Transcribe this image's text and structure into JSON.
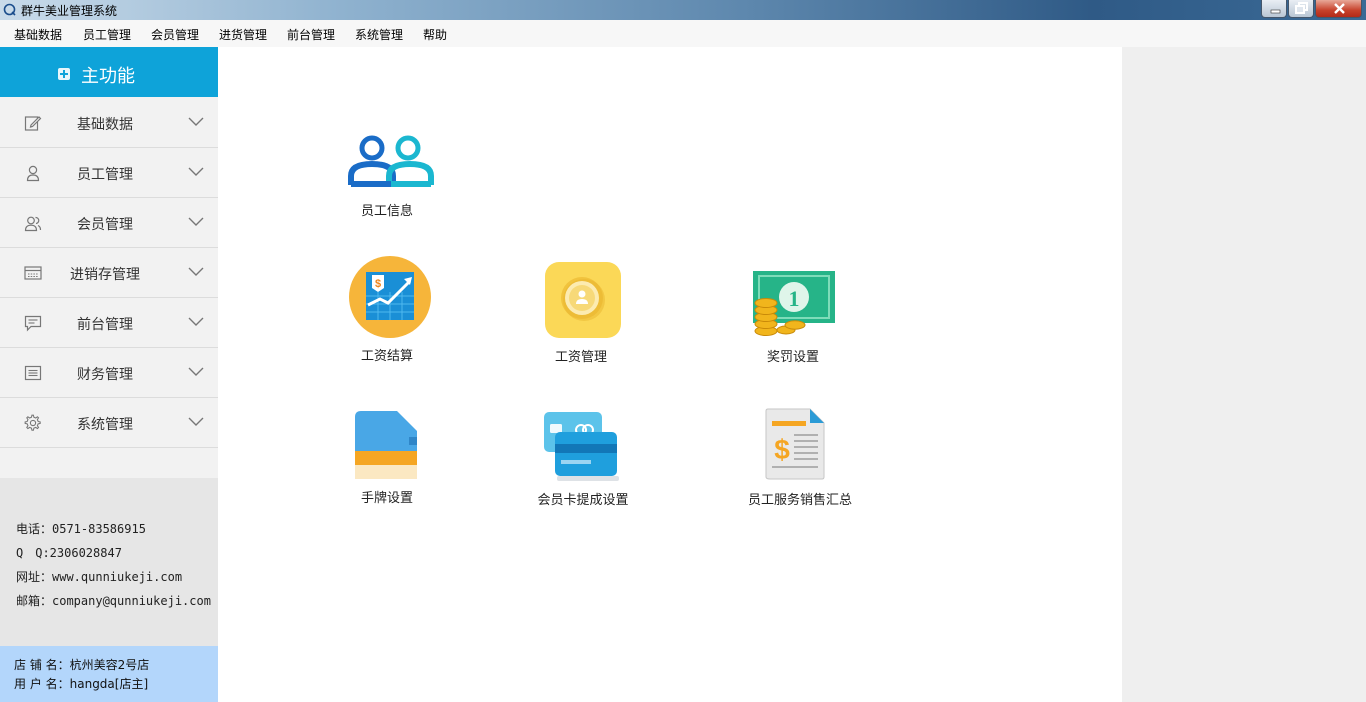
{
  "window": {
    "title": "群牛美业管理系统",
    "buttons": [
      "minimize",
      "maximize",
      "close"
    ]
  },
  "menubar": {
    "items": [
      "基础数据",
      "员工管理",
      "会员管理",
      "进货管理",
      "前台管理",
      "系统管理",
      "帮助"
    ]
  },
  "sidebar": {
    "header": "主功能",
    "items": [
      {
        "label": "基础数据",
        "icon": "edit-icon"
      },
      {
        "label": "员工管理",
        "icon": "person-icon"
      },
      {
        "label": "会员管理",
        "icon": "members-icon"
      },
      {
        "label": "进销存管理",
        "icon": "inventory-icon"
      },
      {
        "label": "前台管理",
        "icon": "message-icon"
      },
      {
        "label": "财务管理",
        "icon": "ledger-icon"
      },
      {
        "label": "系统管理",
        "icon": "gear-icon"
      }
    ]
  },
  "contact": {
    "phone": "电话：0571-83586915",
    "qq": "Q　Q:2306028847",
    "website": "网址：www.qunniukeji.com",
    "email": "邮箱：company@qunniukeji.com"
  },
  "user": {
    "store": "店 铺 名：杭州美容2号店",
    "username": "用 户 名：hangda[店主]"
  },
  "tiles": [
    {
      "label": "员工信息",
      "icon": "employees-icon"
    },
    {
      "label": "工资结算",
      "icon": "salary-chart-icon"
    },
    {
      "label": "工资管理",
      "icon": "coin-icon"
    },
    {
      "label": "奖罚设置",
      "icon": "money-icon"
    },
    {
      "label": "手牌设置",
      "icon": "sd-card-icon"
    },
    {
      "label": "会员卡提成设置",
      "icon": "member-card-icon"
    },
    {
      "label": "员工服务销售汇总",
      "icon": "sales-report-icon"
    }
  ],
  "colors": {
    "accent": "#0ea3d9",
    "user_box": "#b3d6fb",
    "sidebar_bg": "#f2f2f2"
  }
}
